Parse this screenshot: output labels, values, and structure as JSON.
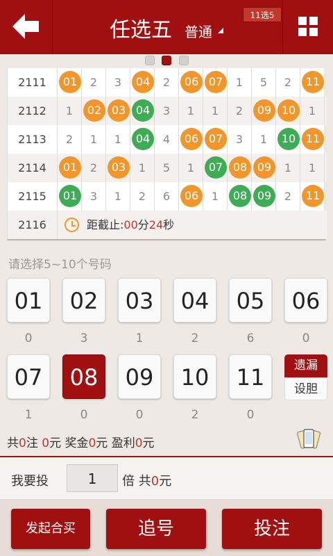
{
  "header": {
    "title": "任选五",
    "subtitle": "普通",
    "lottery_badge": "11选5"
  },
  "history": {
    "rows": [
      {
        "issue": "2111",
        "cells": [
          {
            "v": "01",
            "c": "orange"
          },
          {
            "v": "2"
          },
          {
            "v": "3"
          },
          {
            "v": "04",
            "c": "orange"
          },
          {
            "v": "2"
          },
          {
            "v": "06",
            "c": "orange"
          },
          {
            "v": "07",
            "c": "orange"
          },
          {
            "v": "1"
          },
          {
            "v": "5"
          },
          {
            "v": "2"
          },
          {
            "v": "11",
            "c": "orange"
          }
        ]
      },
      {
        "issue": "2112",
        "cells": [
          {
            "v": "1"
          },
          {
            "v": "02",
            "c": "orange"
          },
          {
            "v": "03",
            "c": "orange"
          },
          {
            "v": "04",
            "c": "green"
          },
          {
            "v": "3"
          },
          {
            "v": "1"
          },
          {
            "v": "1"
          },
          {
            "v": "2"
          },
          {
            "v": "09",
            "c": "orange"
          },
          {
            "v": "10",
            "c": "orange"
          },
          {
            "v": "1"
          }
        ]
      },
      {
        "issue": "2113",
        "cells": [
          {
            "v": "2"
          },
          {
            "v": "1"
          },
          {
            "v": "1"
          },
          {
            "v": "04",
            "c": "green"
          },
          {
            "v": "4"
          },
          {
            "v": "06",
            "c": "orange"
          },
          {
            "v": "07",
            "c": "orange"
          },
          {
            "v": "3"
          },
          {
            "v": "1"
          },
          {
            "v": "10",
            "c": "green"
          },
          {
            "v": "11",
            "c": "orange"
          }
        ]
      },
      {
        "issue": "2114",
        "cells": [
          {
            "v": "01",
            "c": "orange"
          },
          {
            "v": "2"
          },
          {
            "v": "03",
            "c": "orange"
          },
          {
            "v": "1"
          },
          {
            "v": "5"
          },
          {
            "v": "1"
          },
          {
            "v": "07",
            "c": "green"
          },
          {
            "v": "08",
            "c": "orange"
          },
          {
            "v": "09",
            "c": "orange"
          },
          {
            "v": "1"
          },
          {
            "v": "1"
          }
        ]
      },
      {
        "issue": "2115",
        "cells": [
          {
            "v": "01",
            "c": "green"
          },
          {
            "v": "3"
          },
          {
            "v": "1"
          },
          {
            "v": "2"
          },
          {
            "v": "6"
          },
          {
            "v": "06",
            "c": "orange"
          },
          {
            "v": "1"
          },
          {
            "v": "08",
            "c": "green"
          },
          {
            "v": "09",
            "c": "green"
          },
          {
            "v": "2"
          },
          {
            "v": "11",
            "c": "orange"
          }
        ]
      }
    ],
    "current_issue": "2116",
    "countdown": {
      "prefix": "距截止:",
      "minutes": "00",
      "min_unit": "分",
      "seconds": "24",
      "sec_unit": "秒"
    }
  },
  "selection": {
    "prompt": "请选择5~10个号码",
    "numbers": [
      {
        "label": "01",
        "miss": "0",
        "selected": false
      },
      {
        "label": "02",
        "miss": "3",
        "selected": false
      },
      {
        "label": "03",
        "miss": "1",
        "selected": false
      },
      {
        "label": "04",
        "miss": "2",
        "selected": false
      },
      {
        "label": "05",
        "miss": "6",
        "selected": false
      },
      {
        "label": "06",
        "miss": "0",
        "selected": false
      },
      {
        "label": "07",
        "miss": "1",
        "selected": false
      },
      {
        "label": "08",
        "miss": "0",
        "selected": true
      },
      {
        "label": "09",
        "miss": "0",
        "selected": false
      },
      {
        "label": "10",
        "miss": "2",
        "selected": false
      },
      {
        "label": "11",
        "miss": "0",
        "selected": false
      }
    ],
    "omission_label": "遗漏",
    "banker_label": "设胆"
  },
  "summary": {
    "total_prefix": "共",
    "bets": "0",
    "bets_unit": "注",
    "amount": "0",
    "amount_unit": "元",
    "prize_label": "奖金",
    "prize": "0",
    "prize_unit": "元",
    "profit_label": "盈利",
    "profit": "0",
    "profit_unit": "元"
  },
  "multiplier": {
    "label": "我要投",
    "value": "1",
    "unit": "倍",
    "total_label": "共",
    "total_value": "0",
    "total_unit": "元"
  },
  "actions": {
    "group_buy": "发起合买",
    "chase": "追号",
    "bet": "投注"
  },
  "colors": {
    "primary": "#a01010",
    "ball_orange": "#f2962c",
    "ball_green": "#3eab55"
  }
}
